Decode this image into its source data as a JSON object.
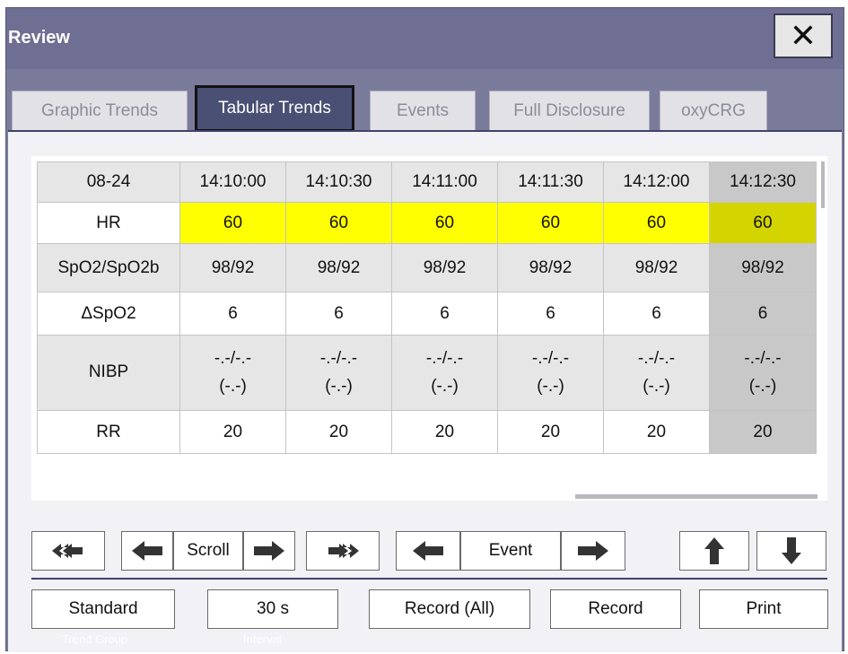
{
  "window": {
    "title": "Review",
    "close_label": "✕"
  },
  "tabs": [
    {
      "label": "Graphic Trends",
      "active": false
    },
    {
      "label": "Tabular Trends",
      "active": true
    },
    {
      "label": "Events",
      "active": false
    },
    {
      "label": "Full Disclosure",
      "active": false
    },
    {
      "label": "oxyCRG",
      "active": false
    }
  ],
  "table": {
    "date": "08-24",
    "times": [
      "14:10:00",
      "14:10:30",
      "14:11:00",
      "14:11:30",
      "14:12:00",
      "14:12:30"
    ],
    "rows": [
      {
        "label": "HR",
        "values": [
          "60",
          "60",
          "60",
          "60",
          "60",
          "60"
        ],
        "highlight": "#ffff00"
      },
      {
        "label": "SpO2/SpO2b",
        "values": [
          "98/92",
          "98/92",
          "98/92",
          "98/92",
          "98/92",
          "98/92"
        ]
      },
      {
        "label": "ΔSpO2",
        "values": [
          "6",
          "6",
          "6",
          "6",
          "6",
          "6"
        ]
      },
      {
        "label": "NIBP",
        "values": [
          "-.-/-.-",
          "-.-/-.-",
          "-.-/-.-",
          "-.-/-.-",
          "-.-/-.-",
          "-.-/-.-"
        ],
        "values2": [
          "(-.-)",
          "(-.-)",
          "(-.-)",
          "(-.-)",
          "(-.-)",
          "(-.-)"
        ]
      },
      {
        "label": "RR",
        "values": [
          "20",
          "20",
          "20",
          "20",
          "20",
          "20"
        ]
      }
    ]
  },
  "controls": {
    "scroll_label": "Scroll",
    "event_label": "Event"
  },
  "bottom": {
    "trend_group_value": "Standard",
    "trend_group_caption": "Trend Group",
    "interval_value": "30 s",
    "interval_caption": "Interval",
    "record_all_label": "Record (All)",
    "record_label": "Record",
    "print_label": "Print"
  },
  "colors": {
    "accent": "#7a7b9b",
    "active_tab": "#4a4f74",
    "hr_highlight": "#ffff00"
  }
}
